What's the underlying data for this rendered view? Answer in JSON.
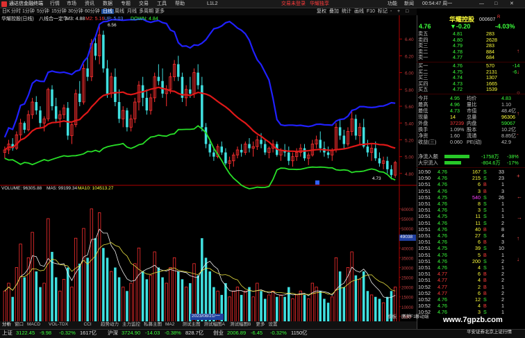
{
  "window": {
    "title": "通达信金融终端",
    "menu": [
      "行情",
      "市场",
      "资讯",
      "数据",
      "专题",
      "交易",
      "工具",
      "帮助"
    ],
    "ad": "L1L2",
    "promo1": "交易未登录",
    "promo2": "华耀独享",
    "controls": [
      "功能",
      "新闻"
    ],
    "clock": "00:54:47 周一"
  },
  "toolbar": {
    "items": [
      "日K",
      "分时",
      "1分钟",
      "5分钟",
      "15分钟",
      "30分钟",
      "60分钟",
      "日线",
      "周线",
      "月线",
      "多周期",
      "更多"
    ],
    "right_items": [
      "复权",
      "叠加",
      "统计",
      "画线",
      "F10",
      "标记",
      "-",
      "+",
      "□"
    ]
  },
  "stock": {
    "name": "华耀控股(日线)",
    "indicator": "八线合一定牛",
    "m3": "M3: 4.88",
    "m2": "M2: 5.16",
    "up": "UP: 5.03",
    "down": "DOWN: 4.84",
    "high_label": "6.56",
    "low_label": "4.73"
  },
  "price_axis": [
    "6.40",
    "6.20",
    "6.00",
    "5.80",
    "5.60",
    "5.40",
    "5.20",
    "5.00",
    "4.80"
  ],
  "volume": {
    "title": "VOLUME: 96305.88",
    "ma5": "MA5: 99199.34",
    "ma10": "MA10: 104513.27",
    "axis": [
      "60000",
      "55000",
      "50000",
      "45000",
      "40000",
      "35000",
      "30000",
      "25000",
      "20000",
      "15000",
      "10000",
      "5000"
    ],
    "mark": "49038",
    "unit": "X10"
  },
  "date_label": "2023/08/21/一",
  "chart_data": {
    "type": "bar",
    "candles": [
      [
        5.05,
        5.12,
        4.98,
        5.08
      ],
      [
        5.08,
        5.2,
        5.03,
        5.15
      ],
      [
        5.15,
        5.22,
        5.07,
        5.1
      ],
      [
        5.1,
        5.3,
        5.08,
        5.26
      ],
      [
        5.26,
        5.45,
        5.2,
        5.4
      ],
      [
        5.4,
        5.42,
        5.28,
        5.32
      ],
      [
        5.32,
        5.55,
        5.3,
        5.5
      ],
      [
        5.5,
        5.7,
        5.45,
        5.65
      ],
      [
        5.65,
        5.72,
        5.5,
        5.55
      ],
      [
        5.55,
        5.6,
        5.35,
        5.4
      ],
      [
        5.4,
        5.48,
        5.3,
        5.45
      ],
      [
        5.45,
        5.82,
        5.42,
        5.8
      ],
      [
        5.8,
        5.85,
        5.55,
        5.6
      ],
      [
        5.6,
        5.7,
        5.4,
        5.45
      ],
      [
        5.45,
        5.55,
        5.35,
        5.5
      ],
      [
        5.5,
        5.62,
        5.45,
        5.58
      ],
      [
        5.58,
        5.65,
        5.2,
        5.25
      ],
      [
        5.25,
        5.4,
        5.15,
        5.38
      ],
      [
        5.38,
        5.8,
        5.35,
        5.75
      ],
      [
        5.75,
        5.9,
        5.6,
        5.65
      ],
      [
        5.65,
        6.1,
        5.62,
        6.05
      ],
      [
        6.05,
        6.2,
        5.9,
        5.95
      ],
      [
        5.95,
        6.4,
        5.9,
        6.35
      ],
      [
        6.35,
        6.45,
        6.15,
        6.2
      ],
      [
        6.2,
        6.56,
        6.1,
        6.45
      ],
      [
        6.45,
        6.5,
        6.0,
        6.05
      ],
      [
        6.05,
        6.15,
        5.7,
        5.75
      ],
      [
        5.75,
        6.0,
        5.7,
        5.95
      ],
      [
        5.95,
        6.05,
        5.6,
        5.65
      ],
      [
        5.65,
        5.8,
        5.4,
        5.45
      ],
      [
        5.45,
        5.6,
        5.35,
        5.55
      ],
      [
        5.55,
        5.58,
        5.3,
        5.35
      ],
      [
        5.35,
        5.5,
        5.3,
        5.45
      ],
      [
        5.45,
        5.7,
        5.4,
        5.65
      ],
      [
        5.65,
        5.9,
        5.55,
        5.85
      ],
      [
        5.85,
        5.95,
        5.6,
        5.7
      ],
      [
        5.7,
        5.8,
        5.5,
        5.55
      ],
      [
        5.55,
        5.75,
        5.5,
        5.7
      ],
      [
        5.7,
        6.0,
        5.65,
        5.95
      ],
      [
        5.95,
        6.1,
        5.85,
        5.9
      ],
      [
        5.9,
        6.05,
        5.7,
        5.75
      ],
      [
        5.75,
        5.85,
        5.6,
        5.8
      ],
      [
        5.8,
        6.0,
        5.75,
        5.95
      ],
      [
        5.95,
        6.15,
        5.9,
        6.1
      ],
      [
        6.1,
        6.2,
        5.9,
        5.95
      ],
      [
        5.95,
        6.0,
        5.65,
        5.7
      ],
      [
        5.7,
        5.85,
        5.6,
        5.8
      ],
      [
        5.8,
        5.95,
        5.7,
        5.75
      ],
      [
        5.75,
        6.05,
        5.7,
        6.0
      ],
      [
        6.0,
        6.1,
        5.8,
        5.85
      ],
      [
        5.85,
        5.95,
        5.3,
        5.35
      ],
      [
        5.35,
        5.4,
        5.1,
        5.15
      ],
      [
        5.15,
        5.2,
        5.0,
        5.05
      ],
      [
        5.05,
        5.1,
        4.95,
        5.0
      ],
      [
        5.0,
        5.15,
        4.98,
        5.12
      ],
      [
        5.12,
        5.18,
        5.02,
        5.05
      ],
      [
        5.05,
        5.1,
        4.9,
        4.92
      ],
      [
        4.92,
        5.0,
        4.85,
        4.95
      ],
      [
        4.95,
        5.05,
        4.88,
        5.02
      ],
      [
        5.02,
        5.12,
        4.98,
        5.08
      ],
      [
        5.08,
        5.15,
        5.0,
        5.05
      ],
      [
        5.05,
        5.18,
        5.02,
        5.15
      ],
      [
        5.15,
        5.22,
        5.05,
        5.1
      ],
      [
        5.1,
        5.18,
        5.0,
        5.12
      ],
      [
        5.12,
        5.25,
        5.08,
        5.2
      ],
      [
        5.2,
        5.28,
        5.1,
        5.15
      ],
      [
        5.15,
        5.2,
        5.02,
        5.05
      ],
      [
        5.05,
        5.12,
        4.98,
        5.1
      ],
      [
        5.1,
        5.2,
        5.05,
        5.15
      ],
      [
        5.15,
        5.18,
        5.0,
        5.02
      ],
      [
        5.02,
        5.1,
        4.95,
        5.08
      ],
      [
        5.08,
        5.15,
        5.0,
        5.05
      ],
      [
        5.05,
        5.12,
        4.9,
        4.95
      ],
      [
        4.95,
        5.05,
        4.88,
        5.0
      ],
      [
        5.0,
        5.1,
        4.95,
        5.05
      ],
      [
        5.05,
        5.15,
        5.0,
        5.1
      ],
      [
        5.1,
        5.15,
        4.95,
        4.98
      ],
      [
        4.98,
        5.05,
        4.9,
        5.02
      ],
      [
        5.02,
        5.2,
        5.0,
        5.15
      ],
      [
        5.15,
        5.25,
        5.1,
        5.2
      ],
      [
        5.2,
        5.3,
        5.05,
        5.1
      ],
      [
        5.1,
        5.18,
        5.0,
        5.05
      ],
      [
        5.05,
        5.12,
        4.98,
        5.02
      ],
      [
        5.02,
        5.1,
        4.95,
        5.08
      ],
      [
        5.08,
        5.4,
        5.05,
        5.35
      ],
      [
        5.35,
        5.45,
        5.2,
        5.25
      ],
      [
        5.25,
        5.32,
        5.1,
        5.15
      ],
      [
        5.15,
        5.35,
        5.12,
        5.3
      ],
      [
        5.3,
        5.55,
        5.25,
        5.45
      ],
      [
        5.45,
        5.5,
        5.2,
        5.25
      ],
      [
        5.25,
        5.4,
        5.15,
        5.35
      ],
      [
        5.35,
        5.45,
        5.1,
        5.12
      ],
      [
        5.12,
        5.2,
        5.0,
        5.05
      ],
      [
        5.05,
        5.15,
        4.95,
        5.1
      ],
      [
        5.1,
        5.18,
        4.95,
        4.98
      ],
      [
        4.98,
        5.05,
        4.88,
        4.92
      ],
      [
        4.92,
        5.0,
        4.85,
        4.95
      ],
      [
        4.95,
        5.0,
        4.8,
        4.85
      ],
      [
        4.85,
        4.9,
        4.73,
        4.78
      ],
      [
        4.78,
        4.95,
        4.75,
        4.93
      ]
    ],
    "volumes": [
      18,
      22,
      15,
      30,
      42,
      25,
      35,
      48,
      28,
      20,
      22,
      55,
      38,
      25,
      18,
      24,
      30,
      20,
      45,
      32,
      50,
      35,
      60,
      45,
      58,
      40,
      35,
      28,
      30,
      25,
      20,
      18,
      22,
      32,
      40,
      28,
      24,
      26,
      38,
      30,
      25,
      22,
      30,
      35,
      28,
      24,
      20,
      22,
      32,
      26,
      45,
      35,
      28,
      20,
      18,
      16,
      22,
      15,
      18,
      20,
      16,
      18,
      20,
      15,
      22,
      18,
      14,
      16,
      18,
      15,
      16,
      15,
      20,
      14,
      16,
      18,
      16,
      14,
      22,
      20,
      18,
      14,
      12,
      15,
      35,
      28,
      20,
      30,
      38,
      26,
      24,
      28,
      18,
      16,
      15,
      14,
      12,
      15,
      18,
      20
    ],
    "title": "八线合一定牛",
    "ylim": [
      4.7,
      6.6
    ]
  },
  "quote": {
    "name": "华耀控股",
    "code": "000607",
    "tag": "R",
    "price": "4.76",
    "change": "▼-0.20",
    "pct": "-4.03%",
    "asks": [
      [
        "卖五",
        "4.81",
        "283"
      ],
      [
        "卖四",
        "4.80",
        "2628"
      ],
      [
        "卖三",
        "4.79",
        "283"
      ],
      [
        "卖二",
        "4.78",
        "884"
      ],
      [
        "卖一",
        "4.77",
        "684"
      ]
    ],
    "bids": [
      [
        "买一",
        "4.76",
        "570",
        "-14"
      ],
      [
        "买二",
        "4.75",
        "2131",
        "-6"
      ],
      [
        "买三",
        "4.74",
        "1307",
        ""
      ],
      [
        "买四",
        "4.73",
        "1665",
        ""
      ],
      [
        "买五",
        "4.72",
        "1539",
        ""
      ]
    ],
    "stats": [
      [
        "今开",
        "4.95",
        "均价",
        "4.83"
      ],
      [
        "最高",
        "4.96",
        "量比",
        "1.10"
      ],
      [
        "最低",
        "4.73",
        "市值",
        "48.4亿"
      ],
      [
        "现量",
        "14",
        "总量",
        "96306"
      ],
      [
        "外盘",
        "37239",
        "内盘",
        "59067"
      ],
      [
        "换手",
        "1.09%",
        "股本",
        "10.2亿"
      ],
      [
        "净资",
        "1.60",
        "流通",
        "8.85亿"
      ],
      [
        "收益(三)",
        "0.060",
        "PE(动)",
        "42.9"
      ]
    ],
    "flow": [
      [
        "净流入额",
        "-1758万",
        "-38%"
      ],
      [
        "大宗流入",
        "-804.6万",
        "-17%"
      ]
    ],
    "ticks": [
      [
        "10:50",
        "4.76",
        "167",
        "S",
        "33"
      ],
      [
        "10:50",
        "4.76",
        "215",
        "S",
        "23"
      ],
      [
        "10:51",
        "4.76",
        "6",
        "B",
        "1"
      ],
      [
        "10:51",
        "4.76",
        "3",
        "B",
        "3"
      ],
      [
        "10:51",
        "4.75",
        "540",
        "S",
        "26"
      ],
      [
        "10:51",
        "4.76",
        "8",
        "S",
        "1"
      ],
      [
        "10:51",
        "4.76",
        "3",
        "S",
        "1"
      ],
      [
        "10:51",
        "4.75",
        "11",
        "S",
        "1"
      ],
      [
        "10:51",
        "4.76",
        "11",
        "S",
        "2"
      ],
      [
        "10:51",
        "4.76",
        "40",
        "B",
        "8"
      ],
      [
        "10:51",
        "4.76",
        "27",
        "S",
        "4"
      ],
      [
        "10:51",
        "4.76",
        "6",
        "B",
        "3"
      ],
      [
        "10:51",
        "4.75",
        "39",
        "S",
        "10"
      ],
      [
        "10:51",
        "4.76",
        "5",
        "B",
        "1"
      ],
      [
        "10:51",
        "4.76",
        "200",
        "S",
        "2"
      ],
      [
        "10:51",
        "4.76",
        "4",
        "S",
        "1"
      ],
      [
        "10:51",
        "4.77",
        "6",
        "B",
        "2"
      ],
      [
        "10:51",
        "4.77",
        "4",
        "B",
        "2"
      ],
      [
        "10:52",
        "4.77",
        "2",
        "B",
        "1"
      ],
      [
        "10:52",
        "4.77",
        "6",
        "B",
        "2"
      ],
      [
        "10:52",
        "4.76",
        "12",
        "S",
        "2"
      ],
      [
        "10:52",
        "4.76",
        "4",
        "B",
        "1"
      ],
      [
        "10:52",
        "4.76",
        "3",
        "S",
        "1"
      ]
    ]
  },
  "side_icons": [
    "↑",
    "↓",
    "○",
    "↑",
    "-",
    "-",
    "+",
    "←",
    "→",
    "↑",
    "↓"
  ],
  "indicator_tabs": [
    "分析",
    "窗口",
    "MACD",
    "VOL-TDX",
    "CCI",
    "趋势动力",
    "主力监控",
    "私募主图",
    "MA2",
    "测试主图",
    "测试幅图A",
    "测试幅图B",
    "更多",
    "设置"
  ],
  "bottom_tabs": [
    "上证",
    "关联报价",
    "资金分布",
    "综合资讯",
    "行业资讯",
    "互动问答",
    "首页新闻资讯"
  ],
  "bottom_right": [
    "模板",
    "图文F10",
    "移动端"
  ],
  "market": [
    {
      "name": "上证",
      "value": "3122.45",
      "chg": "-9.98",
      "pct": "-0.32%",
      "amt": "1617亿"
    },
    {
      "name": "沪深",
      "value": "3724.90",
      "chg": "-14.03",
      "pct": "-0.38%",
      "amt": "828.7亿"
    },
    {
      "name": "创业",
      "value": "2006.89",
      "chg": "-6.45",
      "pct": "-0.32%",
      "amt": "1150亿"
    }
  ],
  "server": "平安证券北京上证行情",
  "watermark": "www.7gpzb.com"
}
